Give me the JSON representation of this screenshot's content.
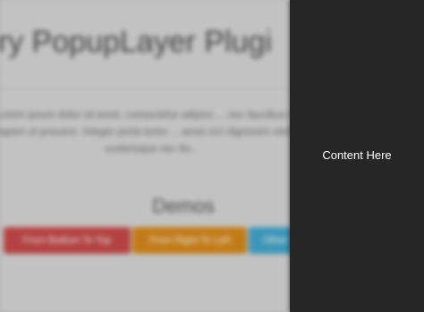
{
  "background_page": {
    "title": "uery PopupLayer Plugi",
    "body_text": "Lorem ipsum dolor sit amet, consectetur adipisc ... nec faucibus eget sapien ut posuere. Integer porta tortor ... amet orci dignissim eleifend scelerisque nec fer...",
    "demos_heading": "Demos",
    "buttons": [
      {
        "label": "From Bottom To Top",
        "color": "#c94a4a"
      },
      {
        "label": "From Right To Left",
        "color": "#d98a1c"
      },
      {
        "label": "Other",
        "color": "#45a7cf"
      }
    ]
  },
  "popup": {
    "content": "Content Here",
    "background_color": "#262626",
    "text_color": "#ffffff"
  }
}
